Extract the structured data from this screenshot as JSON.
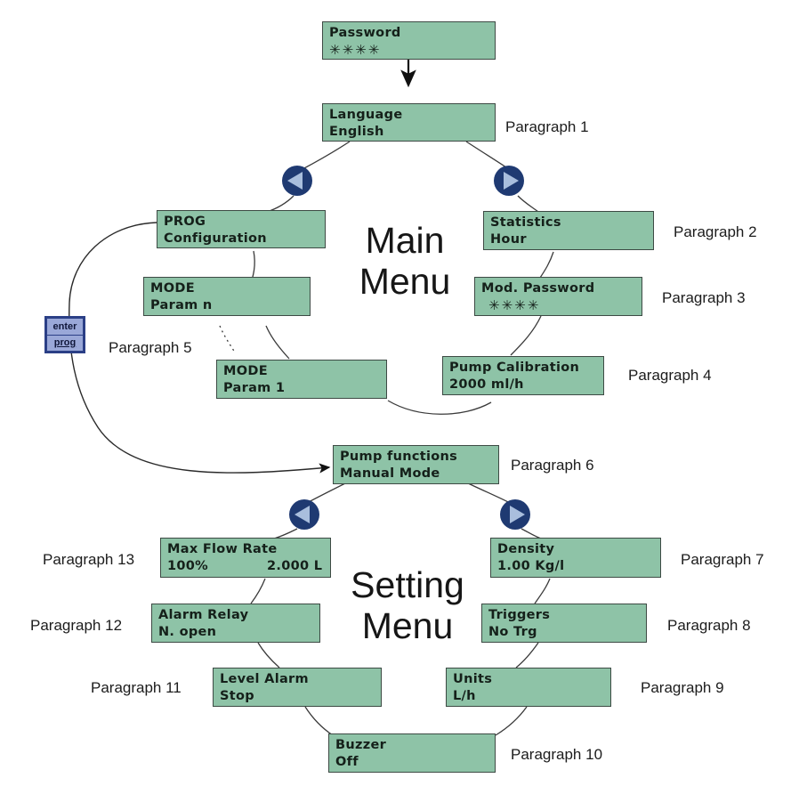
{
  "diagram": {
    "title": "Pump menu navigation diagram",
    "colors": {
      "lcd_background": "#8ec3a7",
      "lcd_border": "#3d4a44",
      "lcd_text": "#15201a",
      "nav_circle": "#1f3a72",
      "nav_triangle": "#a9bedd",
      "key_fill": "#9aa8d8",
      "key_border": "#2b3f86",
      "wire": "#3a3a3a"
    }
  },
  "menus": {
    "main_title_line1": "Main",
    "main_title_line2": "Menu",
    "setting_title_line1": "Setting",
    "setting_title_line2": "Menu"
  },
  "key": {
    "line1": "enter",
    "line2": "prog"
  },
  "nav_buttons": [
    {
      "name": "main-menu-prev",
      "direction": "left"
    },
    {
      "name": "main-menu-next",
      "direction": "right"
    },
    {
      "name": "setting-menu-prev",
      "direction": "left"
    },
    {
      "name": "setting-menu-next",
      "direction": "right"
    }
  ],
  "screens": {
    "password": {
      "line1": "Password",
      "line2": "✳✳✳✳"
    },
    "language": {
      "line1": "Language",
      "line2": "English"
    },
    "prog": {
      "line1": "PROG",
      "line2": "Configuration"
    },
    "mode_param_n": {
      "line1": "MODE",
      "line2": "Param n"
    },
    "mode_param_1": {
      "line1": "MODE",
      "line2": "Param 1"
    },
    "statistics": {
      "line1": "Statistics",
      "line2": "Hour"
    },
    "mod_password": {
      "line1": "Mod. Password",
      "line2": "✳✳✳✳"
    },
    "pump_calibration": {
      "line1": "Pump Calibration",
      "line2": "2000 ml/h"
    },
    "pump_functions": {
      "line1": "Pump functions",
      "line2": "Manual Mode"
    },
    "max_flow_rate": {
      "line1": "Max Flow Rate",
      "line2": "100%",
      "line2_right": "2.000 L"
    },
    "alarm_relay": {
      "line1": "Alarm Relay",
      "line2": "N. open"
    },
    "level_alarm": {
      "line1": "Level Alarm",
      "line2": "Stop"
    },
    "buzzer": {
      "line1": "Buzzer",
      "line2": "Off"
    },
    "density": {
      "line1": "Density",
      "line2": "1.00 Kg/l"
    },
    "triggers": {
      "line1": "Triggers",
      "line2": "No Trg"
    },
    "units": {
      "line1": "Units",
      "line2": "L/h"
    }
  },
  "captions": {
    "p1": "Paragraph 1",
    "p2": "Paragraph 2",
    "p3": "Paragraph 3",
    "p4": "Paragraph 4",
    "p5": "Paragraph 5",
    "p6": "Paragraph 6",
    "p7": "Paragraph 7",
    "p8": "Paragraph 8",
    "p9": "Paragraph 9",
    "p10": "Paragraph 10",
    "p11": "Paragraph 11",
    "p12": "Paragraph 12",
    "p13": "Paragraph 13"
  }
}
